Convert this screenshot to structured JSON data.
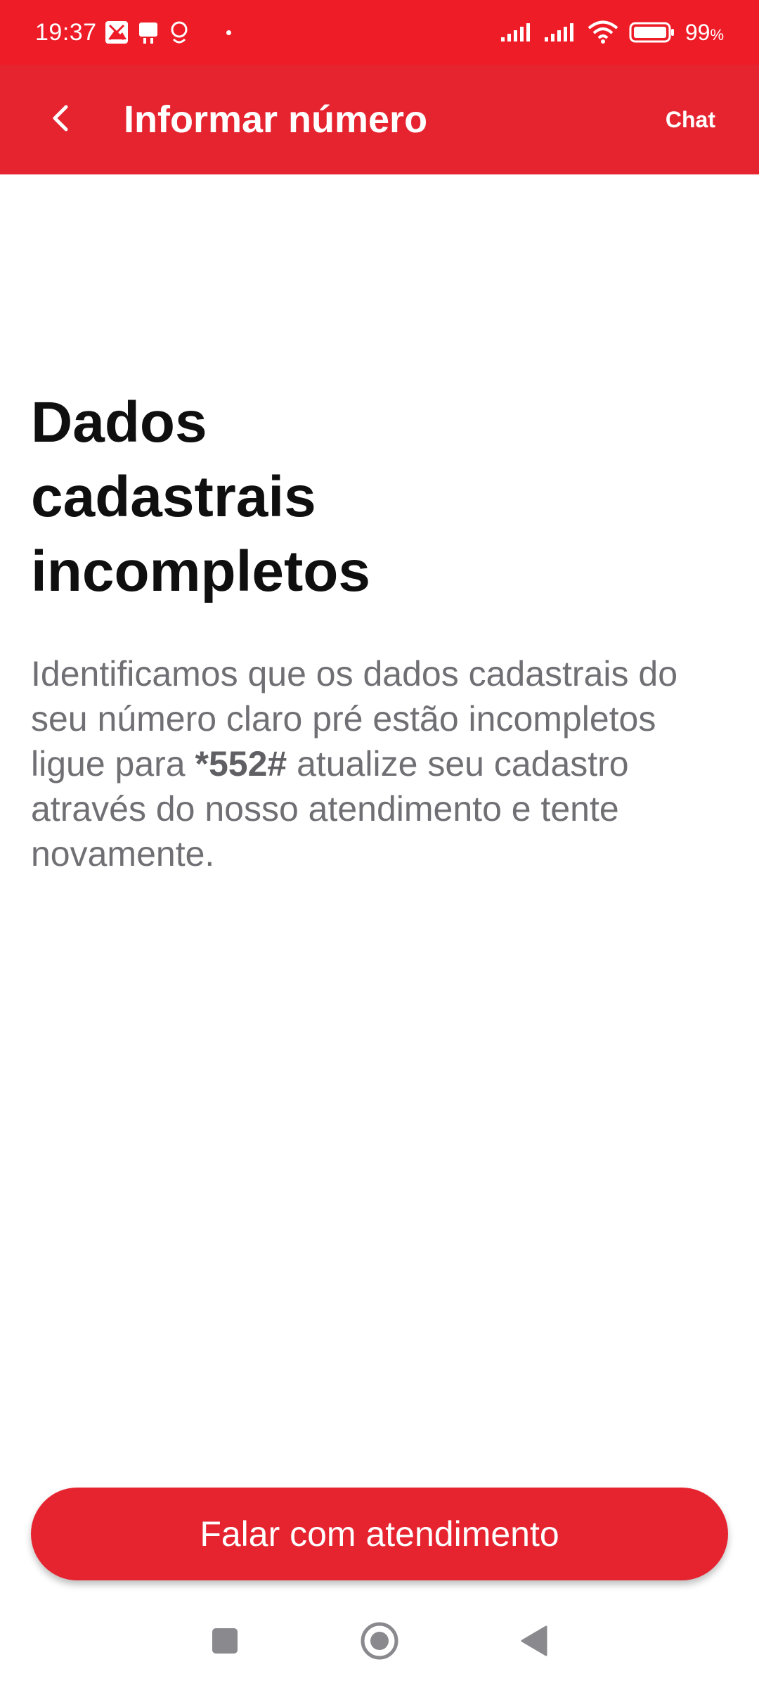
{
  "status_bar": {
    "time": "19:37",
    "battery_percent": "99",
    "battery_unit": "%"
  },
  "app_bar": {
    "title": "Informar número",
    "chat_label": "Chat"
  },
  "content": {
    "title": "Dados cadastrais incompletos",
    "message_before": "Identificamos que os dados cadastrais do seu número claro pré estão incompletos ligue para ",
    "message_code": "*552#",
    "message_after": " atualize seu cadastro através do nosso atendimento e tente novamente."
  },
  "actions": {
    "primary_label": "Falar com atendimento"
  },
  "colors": {
    "status_bar": "#ee1c27",
    "brand_red": "#e52430",
    "text_dark": "#0f0f0f",
    "text_muted": "#6f6f74"
  },
  "icons": {
    "back": "chevron-left-icon",
    "nav_recents": "square-icon",
    "nav_home": "circle-icon",
    "nav_back": "triangle-back-icon"
  }
}
